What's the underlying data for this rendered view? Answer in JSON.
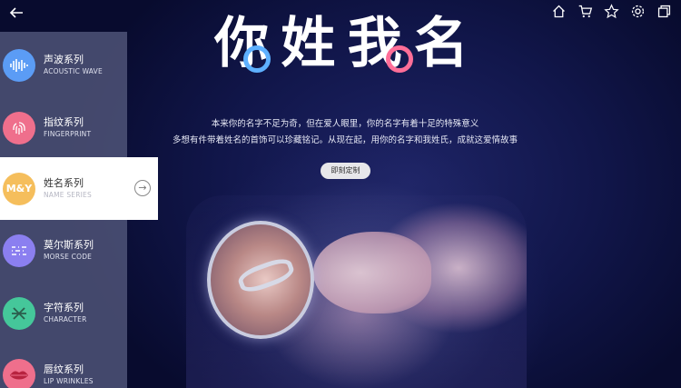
{
  "header": {
    "back_icon": "back-arrow-icon",
    "icons": [
      "home-icon",
      "cart-icon",
      "star-icon",
      "settings-icon",
      "window-icon"
    ]
  },
  "logo": {
    "chars": [
      "你",
      "姓",
      "我",
      "名"
    ]
  },
  "hero": {
    "line1": "本来你的名字不足为奇，但在爱人眼里，你的名字有着十足的特殊意义",
    "line2": "多想有件带着姓名的首饰可以珍藏铭记。从现在起，用你的名字和我姓氏，成就这爱情故事",
    "cta_label": "即刻定制"
  },
  "sidebar": {
    "items": [
      {
        "title": "声波系列",
        "subtitle": "ACOUSTIC WAVE",
        "icon": "sound-wave-icon",
        "color": "#5b9cf5"
      },
      {
        "title": "指纹系列",
        "subtitle": "FINGERPRINT",
        "icon": "fingerprint-icon",
        "color": "#ef6f8c"
      },
      {
        "title": "姓名系列",
        "subtitle": "NAME SERIES",
        "icon": "name-icon",
        "icon_text": "M&Y",
        "color": "#f5be5c"
      },
      {
        "title": "莫尔斯系列",
        "subtitle": "MORSE CODE",
        "icon": "morse-code-icon",
        "color": "#8b7ff0"
      },
      {
        "title": "字符系列",
        "subtitle": "CHARACTER",
        "icon": "character-icon",
        "color": "#45c79a"
      },
      {
        "title": "唇纹系列",
        "subtitle": "LIP WRINKLES",
        "icon": "lips-icon",
        "color": "#ef6f8c"
      }
    ],
    "active_index": 2
  }
}
